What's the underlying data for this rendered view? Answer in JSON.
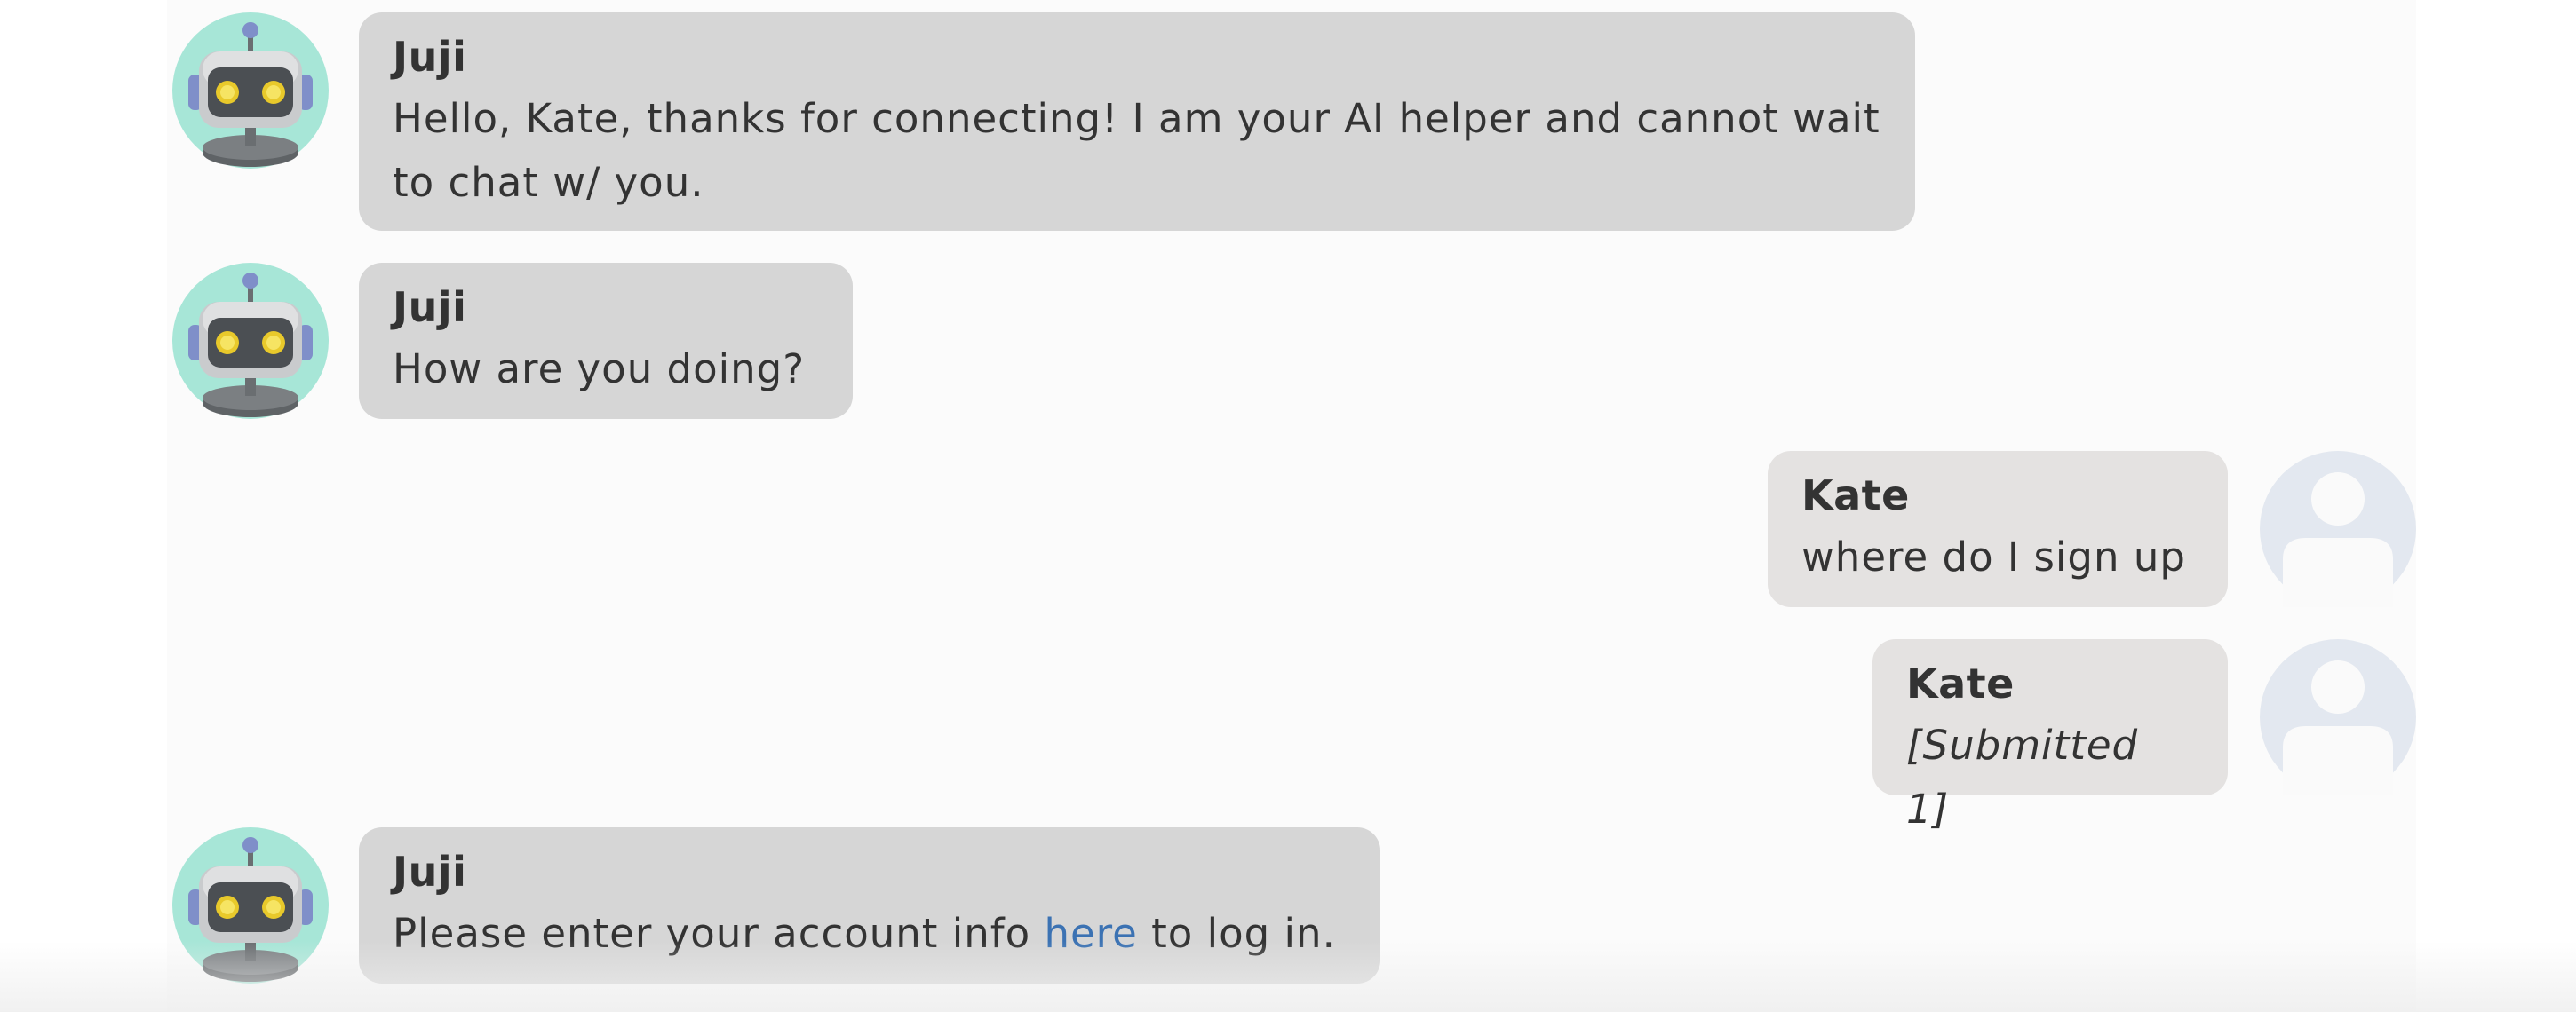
{
  "messages": [
    {
      "sender": "Juji",
      "role": "bot",
      "text": "Hello, Kate, thanks for connecting! I am your AI helper and cannot wait to chat w/ you."
    },
    {
      "sender": "Juji",
      "role": "bot",
      "text": "How are you doing?"
    },
    {
      "sender": "Kate",
      "role": "user",
      "text": "where do I sign up"
    },
    {
      "sender": "Kate",
      "role": "user",
      "text": "[Submitted 1]"
    },
    {
      "sender": "Juji",
      "role": "bot",
      "text_before": "Please enter your account info ",
      "link_text": "here",
      "text_after": " to log in."
    }
  ],
  "colors": {
    "bot_bubble": "#d6d6d6",
    "user_bubble": "#e4e2e1",
    "link": "#3b72b3",
    "bot_avatar_bg": "#a7e6d7",
    "user_avatar_bg": "#e3e8f0"
  },
  "icons": {
    "bot_avatar": "robot-avatar-icon",
    "user_avatar": "user-avatar-icon"
  }
}
